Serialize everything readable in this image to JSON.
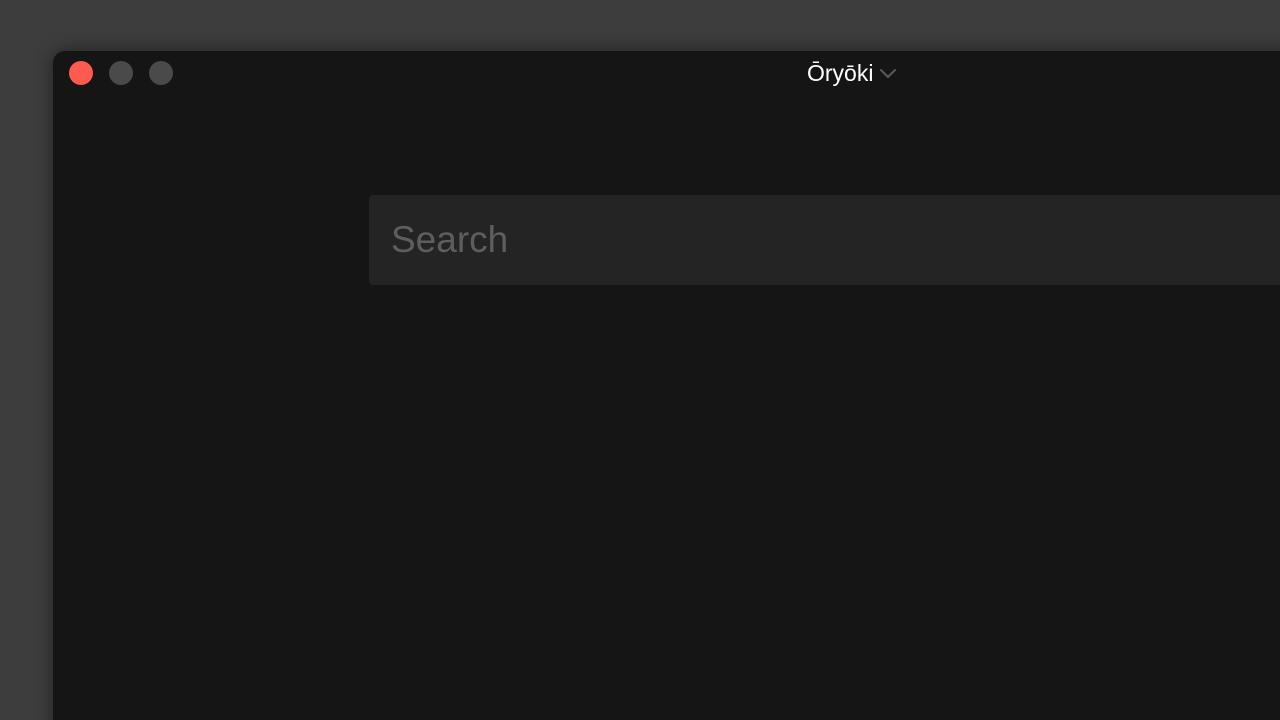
{
  "window": {
    "title": "Ōryōki",
    "title_dropdown_icon": "chevron-down-icon",
    "controls": [
      {
        "name": "close",
        "color": "#ff5a4f"
      },
      {
        "name": "minimize",
        "color": "#4a4a4a"
      },
      {
        "name": "maximize",
        "color": "#4a4a4a"
      }
    ]
  },
  "search": {
    "placeholder": "Search",
    "value": ""
  },
  "colors": {
    "desktop_bg": "#3d3d3d",
    "window_bg": "#151515",
    "search_bg": "#242424",
    "close_accent": "#ff5a4f"
  }
}
